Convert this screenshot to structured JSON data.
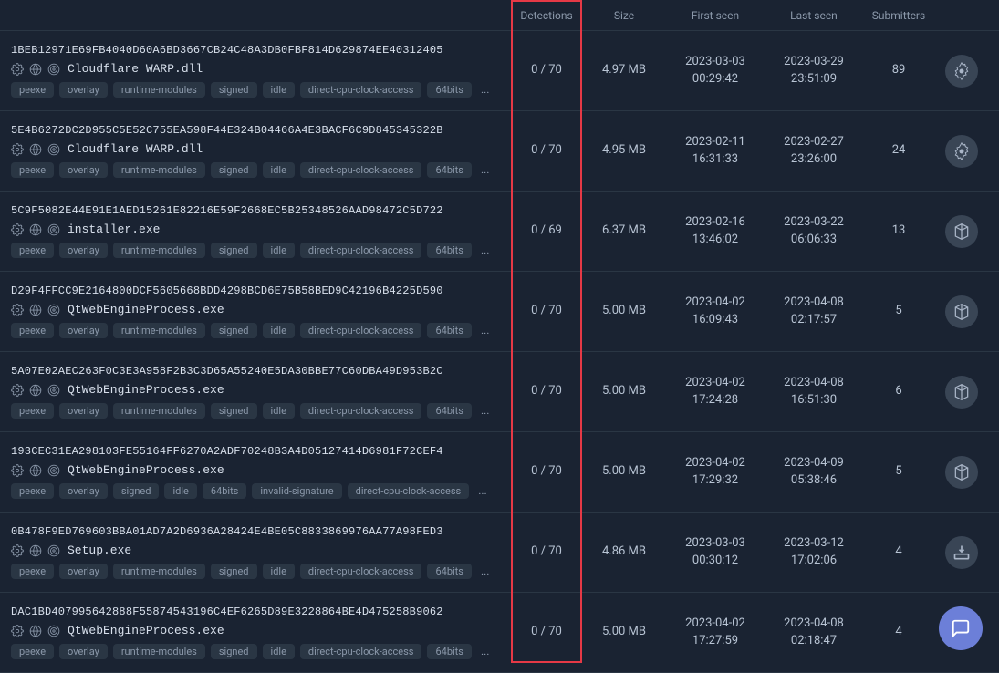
{
  "headers": {
    "detections": "Detections",
    "size": "Size",
    "first_seen": "First seen",
    "last_seen": "Last seen",
    "submitters": "Submitters"
  },
  "rows": [
    {
      "hash": "1BEB12971E69FB4040D60A6BD3667CB24C48A3DB0FBF814D629874EE40312405",
      "filename": "Cloudflare WARP.dll",
      "tags": [
        "peexe",
        "overlay",
        "runtime-modules",
        "signed",
        "idle",
        "direct-cpu-clock-access",
        "64bits"
      ],
      "detections": "0 / 70",
      "size": "4.97 MB",
      "first_seen_d": "2023-03-03",
      "first_seen_t": "00:29:42",
      "last_seen_d": "2023-03-29",
      "last_seen_t": "23:51:09",
      "submitters": "89",
      "icon": "gear"
    },
    {
      "hash": "5E4B6272DC2D955C5E52C755EA598F44E324B04466A4E3BACF6C9D845345322B",
      "filename": "Cloudflare WARP.dll",
      "tags": [
        "peexe",
        "overlay",
        "runtime-modules",
        "signed",
        "idle",
        "direct-cpu-clock-access",
        "64bits"
      ],
      "detections": "0 / 70",
      "size": "4.95 MB",
      "first_seen_d": "2023-02-11",
      "first_seen_t": "16:31:33",
      "last_seen_d": "2023-02-27",
      "last_seen_t": "23:26:00",
      "submitters": "24",
      "icon": "gear"
    },
    {
      "hash": "5C9F5082E44E91E1AED15261E82216E59F2668EC5B25348526AAD98472C5D722",
      "filename": "installer.exe",
      "tags": [
        "peexe",
        "overlay",
        "runtime-modules",
        "signed",
        "idle",
        "direct-cpu-clock-access",
        "64bits"
      ],
      "detections": "0 / 69",
      "size": "6.37 MB",
      "first_seen_d": "2023-02-16",
      "first_seen_t": "13:46:02",
      "last_seen_d": "2023-03-22",
      "last_seen_t": "06:06:33",
      "submitters": "13",
      "icon": "package"
    },
    {
      "hash": "D29F4FFCC9E2164800DCF5605668BDD4298BCD6E75B58BED9C42196B4225D590",
      "filename": "QtWebEngineProcess.exe",
      "tags": [
        "peexe",
        "overlay",
        "runtime-modules",
        "signed",
        "idle",
        "direct-cpu-clock-access",
        "64bits"
      ],
      "detections": "0 / 70",
      "size": "5.00 MB",
      "first_seen_d": "2023-04-02",
      "first_seen_t": "16:09:43",
      "last_seen_d": "2023-04-08",
      "last_seen_t": "02:17:57",
      "submitters": "5",
      "icon": "package"
    },
    {
      "hash": "5A07E02AEC263F0C3E3A958F2B3C3D65A55240E5DA30BBE77C60DBA49D953B2C",
      "filename": "QtWebEngineProcess.exe",
      "tags": [
        "peexe",
        "overlay",
        "runtime-modules",
        "signed",
        "idle",
        "direct-cpu-clock-access",
        "64bits"
      ],
      "detections": "0 / 70",
      "size": "5.00 MB",
      "first_seen_d": "2023-04-02",
      "first_seen_t": "17:24:28",
      "last_seen_d": "2023-04-08",
      "last_seen_t": "16:51:30",
      "submitters": "6",
      "icon": "package"
    },
    {
      "hash": "193CEC31EA298103FE55164FF6270A2ADF70248B3A4D05127414D6981F72CEF4",
      "filename": "QtWebEngineProcess.exe",
      "tags": [
        "peexe",
        "overlay",
        "signed",
        "idle",
        "64bits",
        "invalid-signature",
        "direct-cpu-clock-access"
      ],
      "detections": "0 / 70",
      "size": "5.00 MB",
      "first_seen_d": "2023-04-02",
      "first_seen_t": "17:29:32",
      "last_seen_d": "2023-04-09",
      "last_seen_t": "05:38:46",
      "submitters": "5",
      "icon": "package"
    },
    {
      "hash": "0B478F9ED769603BBA01AD7A2D6936A28424E4BE05C8833869976AA77A98FED3",
      "filename": "Setup.exe",
      "tags": [
        "peexe",
        "overlay",
        "runtime-modules",
        "signed",
        "idle",
        "direct-cpu-clock-access",
        "64bits"
      ],
      "detections": "0 / 70",
      "size": "4.86 MB",
      "first_seen_d": "2023-03-03",
      "first_seen_t": "00:30:12",
      "last_seen_d": "2023-03-12",
      "last_seen_t": "17:02:06",
      "submitters": "4",
      "icon": "installer"
    },
    {
      "hash": "DAC1BD407995642888F55874543196C4EF6265D89E3228864BE4D475258B9062",
      "filename": "QtWebEngineProcess.exe",
      "tags": [
        "peexe",
        "overlay",
        "runtime-modules",
        "signed",
        "idle",
        "direct-cpu-clock-access",
        "64bits"
      ],
      "detections": "0 / 70",
      "size": "5.00 MB",
      "first_seen_d": "2023-04-02",
      "first_seen_t": "17:27:59",
      "last_seen_d": "2023-04-08",
      "last_seen_t": "02:18:47",
      "submitters": "4",
      "icon": "package"
    }
  ],
  "more_label": "..."
}
